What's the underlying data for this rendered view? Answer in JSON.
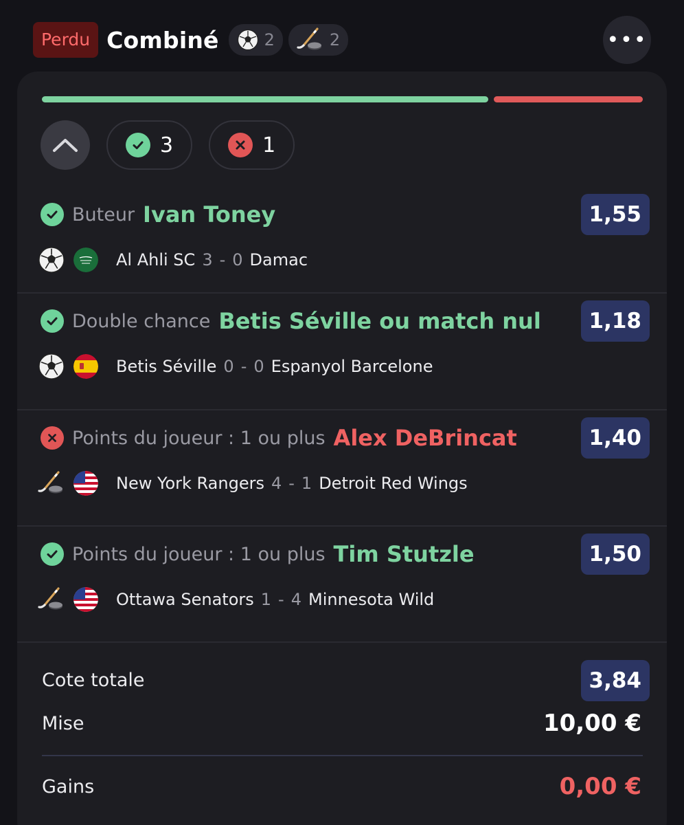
{
  "header": {
    "status": "Perdu",
    "title": "Combiné",
    "sports": [
      {
        "icon": "soccer-ball-icon",
        "count": "2"
      },
      {
        "icon": "hockey-stick-icon",
        "count": "2"
      }
    ]
  },
  "progress": {
    "won": 3,
    "lost": 1
  },
  "summary": {
    "won_count": "3",
    "lost_count": "1"
  },
  "selections": [
    {
      "result": "won",
      "market": "Buteur",
      "pick": "Ivan Toney",
      "odds": "1,55",
      "sport_icon": "soccer-ball-icon",
      "flag": "saudi-arabia-flag-icon",
      "home": "Al Ahli SC",
      "home_score": "3",
      "away_score": "0",
      "away": "Damac"
    },
    {
      "result": "won",
      "market": "Double chance",
      "pick": "Betis Séville ou match nul",
      "odds": "1,18",
      "sport_icon": "soccer-ball-icon",
      "flag": "spain-flag-icon",
      "home": "Betis Séville",
      "home_score": "0",
      "away_score": "0",
      "away": "Espanyol Barcelone"
    },
    {
      "result": "lost",
      "market": "Points du joueur : 1 ou plus",
      "pick": "Alex DeBrincat",
      "odds": "1,40",
      "sport_icon": "hockey-stick-icon",
      "flag": "usa-flag-icon",
      "home": "New York Rangers",
      "home_score": "4",
      "away_score": "1",
      "away": "Detroit Red Wings"
    },
    {
      "result": "won",
      "market": "Points du joueur : 1 ou plus",
      "pick": "Tim Stutzle",
      "odds": "1,50",
      "sport_icon": "hockey-stick-icon",
      "flag": "usa-flag-icon",
      "home": "Ottawa Senators",
      "home_score": "1",
      "away_score": "4",
      "away": "Minnesota Wild"
    }
  ],
  "totals": {
    "odds_label": "Cote totale",
    "odds_value": "3,84",
    "stake_label": "Mise",
    "stake_value": "10,00 €",
    "winnings_label": "Gains",
    "winnings_value": "0,00 €"
  },
  "colors": {
    "win": "#7ed3a0",
    "loss": "#e05a5a",
    "odds_bg": "#2c3563",
    "badge_bg": "#5a1414"
  }
}
